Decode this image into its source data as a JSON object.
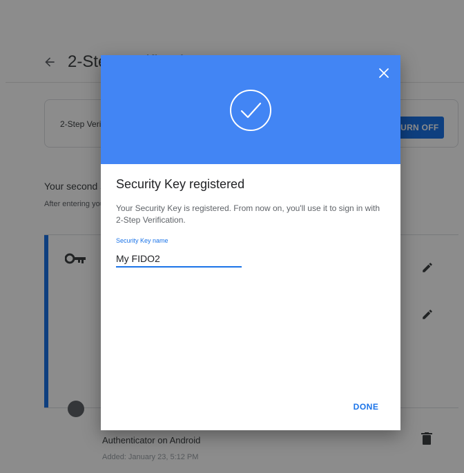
{
  "page": {
    "title": "2-Step Verification",
    "status_text": "2-Step Verification is ON since January 23",
    "turn_off_label": "TURN OFF",
    "section_title": "Your second step",
    "section_subtitle": "After entering your password, you'll be asked for a second verification step.",
    "authenticator": {
      "title": "Authenticator on Android",
      "added": "Added: January 23, 5:12 PM"
    }
  },
  "dialog": {
    "title": "Security Key registered",
    "body": "Your Security Key is registered. From now on, you'll use it to sign in with 2-Step Verification.",
    "field_label": "Security Key name",
    "field_value": "My FIDO2",
    "done_label": "DONE"
  },
  "colors": {
    "accent": "#1a73e8",
    "dialog_header": "#4285f4",
    "scrim": "rgba(0,0,0,0.45)"
  },
  "icons": {
    "back": "arrow-back-icon",
    "key": "key-icon",
    "edit": "edit-pencil-icon",
    "delete": "trash-icon",
    "google": "google-icon",
    "close": "close-icon",
    "success": "check-circle-icon"
  }
}
